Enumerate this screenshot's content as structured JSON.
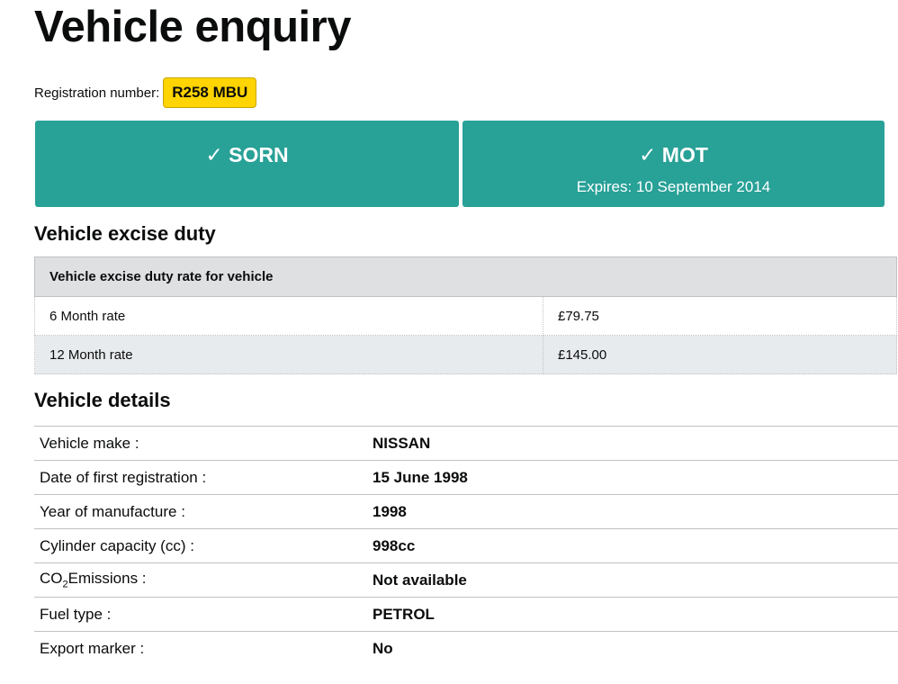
{
  "page": {
    "title": "Vehicle enquiry"
  },
  "registration": {
    "label": "Registration number:",
    "plate": "R258 MBU"
  },
  "status": {
    "sorn": {
      "check": "✓",
      "label": "SORN"
    },
    "mot": {
      "check": "✓",
      "label": "MOT",
      "expires": "Expires: 10 September 2014"
    },
    "panel_color": "#28a197"
  },
  "excise_duty": {
    "heading": "Vehicle excise duty",
    "table_header": "Vehicle excise duty rate for vehicle",
    "rows": [
      {
        "label": "6 Month rate",
        "value": "£79.75"
      },
      {
        "label": "12 Month rate",
        "value": "£145.00"
      }
    ]
  },
  "details": {
    "heading": "Vehicle details",
    "rows": [
      {
        "label": "Vehicle make :",
        "value": "NISSAN"
      },
      {
        "label": "Date of first registration :",
        "value": "15 June 1998"
      },
      {
        "label": "Year of manufacture :",
        "value": "1998"
      },
      {
        "label": "Cylinder capacity (cc) :",
        "value": "998cc"
      },
      {
        "label_prefix": "CO",
        "label_sub": "2",
        "label_suffix": "Emissions :",
        "value": "Not available"
      },
      {
        "label": "Fuel type :",
        "value": "PETROL"
      },
      {
        "label": "Export marker :",
        "value": "No"
      }
    ]
  },
  "colors": {
    "plate_yellow": "#ffd400",
    "table_header_bg": "#dee0e2"
  }
}
